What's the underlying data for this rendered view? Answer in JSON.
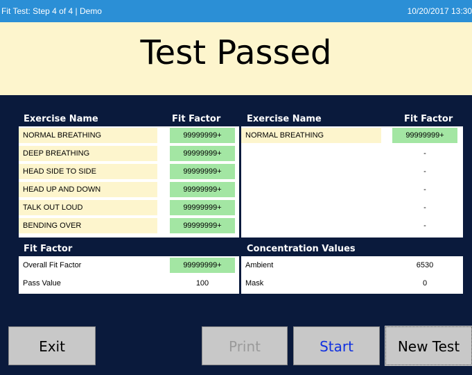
{
  "titlebar": {
    "left": "Fit Test: Step 4 of 4 | Demo",
    "right": "10/20/2017 13:30"
  },
  "result": "Test Passed",
  "exercise_headers": {
    "left_name": "Exercise Name",
    "left_factor": "Fit Factor",
    "right_name": "Exercise Name",
    "right_factor": "Fit Factor"
  },
  "exercises_left": [
    {
      "name": "NORMAL BREATHING",
      "factor": "99999999+"
    },
    {
      "name": "DEEP BREATHING",
      "factor": "99999999+"
    },
    {
      "name": "HEAD SIDE TO SIDE",
      "factor": "99999999+"
    },
    {
      "name": "HEAD UP AND DOWN",
      "factor": "99999999+"
    },
    {
      "name": "TALK OUT LOUD",
      "factor": "99999999+"
    },
    {
      "name": "BENDING OVER",
      "factor": "99999999+"
    }
  ],
  "exercises_right": [
    {
      "name": "NORMAL BREATHING",
      "factor": "99999999+"
    },
    {
      "name": "",
      "factor": "-"
    },
    {
      "name": "",
      "factor": "-"
    },
    {
      "name": "",
      "factor": "-"
    },
    {
      "name": "",
      "factor": "-"
    },
    {
      "name": "",
      "factor": "-"
    }
  ],
  "fit_factor": {
    "header": "Fit Factor",
    "overall_label": "Overall Fit Factor",
    "overall_value": "99999999+",
    "pass_label": "Pass Value",
    "pass_value": "100"
  },
  "concentration": {
    "header": "Concentration Values",
    "ambient_label": "Ambient",
    "ambient_value": "6530",
    "mask_label": "Mask",
    "mask_value": "0"
  },
  "buttons": {
    "exit": "Exit",
    "print": "Print",
    "start": "Start",
    "new_test": "New Test"
  },
  "colors": {
    "background": "#0a1a3c",
    "titlebar": "#2b8fd6",
    "banner": "#fdf5cd",
    "pass_cell": "#a3e6a3",
    "start_text": "#1030e0"
  }
}
